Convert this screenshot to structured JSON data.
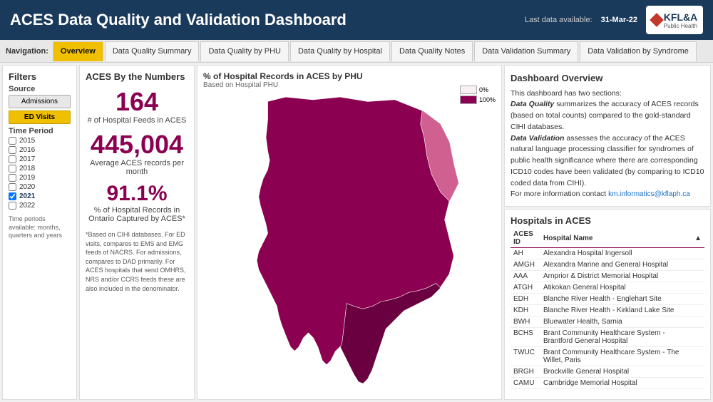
{
  "header": {
    "title": "ACES Data Quality and Validation Dashboard",
    "last_data_label": "Last data available:",
    "last_data_value": "31-Mar-22",
    "logo_main": "KFL&A",
    "logo_sub": "Public Health"
  },
  "nav": {
    "label": "Navigation:",
    "tabs": [
      {
        "id": "overview",
        "label": "Overview",
        "active": true
      },
      {
        "id": "dq-summary",
        "label": "Data Quality Summary",
        "active": false
      },
      {
        "id": "dq-phu",
        "label": "Data Quality by PHU",
        "active": false
      },
      {
        "id": "dq-hospital",
        "label": "Data Quality by Hospital",
        "active": false
      },
      {
        "id": "dq-notes",
        "label": "Data Quality Notes",
        "active": false
      },
      {
        "id": "dv-summary",
        "label": "Data Validation Summary",
        "active": false
      },
      {
        "id": "dv-syndrome",
        "label": "Data Validation by Syndrome",
        "active": false
      }
    ]
  },
  "filters": {
    "title": "Filters",
    "source_label": "Source",
    "btn_admissions": "Admissions",
    "btn_ed": "ED Visits",
    "time_period_label": "Time Period",
    "years": [
      {
        "year": "2015",
        "selected": false
      },
      {
        "year": "2016",
        "selected": false
      },
      {
        "year": "2017",
        "selected": false
      },
      {
        "year": "2018",
        "selected": false
      },
      {
        "year": "2019",
        "selected": false
      },
      {
        "year": "2020",
        "selected": false
      },
      {
        "year": "2021",
        "selected": true
      },
      {
        "year": "2022",
        "selected": false
      }
    ],
    "note": "Time periods available: months, quarters and years"
  },
  "numbers": {
    "title": "ACES By the Numbers",
    "stat1_value": "164",
    "stat1_label": "# of Hospital Feeds in ACES",
    "stat2_value": "445,004",
    "stat2_label": "Average ACES records per month",
    "stat3_value": "91.1%",
    "stat3_label": "% of Hospital Records in Ontario Captured by ACES*",
    "footnote": "*Based on CIHI databases. For ED visits, compares to EMS and EMG feeds of NACRS. For admissions, compares to DAD primarily. For ACES hospitals that send OMHRS, NRS and/or CCRS feeds these are also included in the denominator."
  },
  "map": {
    "title": "% of Hospital Records in ACES by PHU",
    "subtitle": "Based on Hospital PHU",
    "legend_0": "0%",
    "legend_100": "100%"
  },
  "overview": {
    "title": "Dashboard Overview",
    "text1": "This dashboard has two sections:",
    "text2_label": "Data Quality",
    "text2_body": " summarizes the accuracy of ACES records (based on total counts) compared to the gold-standard CIHI databases.",
    "text3_label": "Data Validation",
    "text3_body": " assesses the accuracy of the ACES natural language processing classifier for syndromes of public health significance where there are corresponding ICD10 codes have been validated (by comparing to ICD10 coded data from CIHI).",
    "text4": "For more information contact ",
    "link_text": "km.informatics@kflaph.ca",
    "link_href": "mailto:km.informatics@kflaph.ca"
  },
  "hospitals": {
    "title": "Hospitals in ACES",
    "col_id": "ACES ID",
    "col_name": "Hospital Name",
    "rows": [
      {
        "id": "AH",
        "name": "Alexandra Hospital Ingersoll"
      },
      {
        "id": "AMGH",
        "name": "Alexandra Marine and General Hospital"
      },
      {
        "id": "AAA",
        "name": "Arnprior & District Memorial Hospital"
      },
      {
        "id": "ATGH",
        "name": "Atikokan General Hospital"
      },
      {
        "id": "EDH",
        "name": "Blanche River Health - Englehart Site"
      },
      {
        "id": "KDH",
        "name": "Blanche River Health - Kirkland Lake Site"
      },
      {
        "id": "BWH",
        "name": "Bluewater Health, Sarnia"
      },
      {
        "id": "BCHS",
        "name": "Brant Community Healthcare System - Brantford General Hospital"
      },
      {
        "id": "TWUC",
        "name": "Brant Community Healthcare System - The Willet, Paris"
      },
      {
        "id": "BRGH",
        "name": "Brockville General Hospital"
      },
      {
        "id": "CAMU",
        "name": "Cambridge Memorial Hospital"
      }
    ]
  },
  "colors": {
    "accent": "#8b0050",
    "nav_active": "#f0c000",
    "header_bg": "#1a3a5c",
    "link": "#1a6fc4"
  }
}
